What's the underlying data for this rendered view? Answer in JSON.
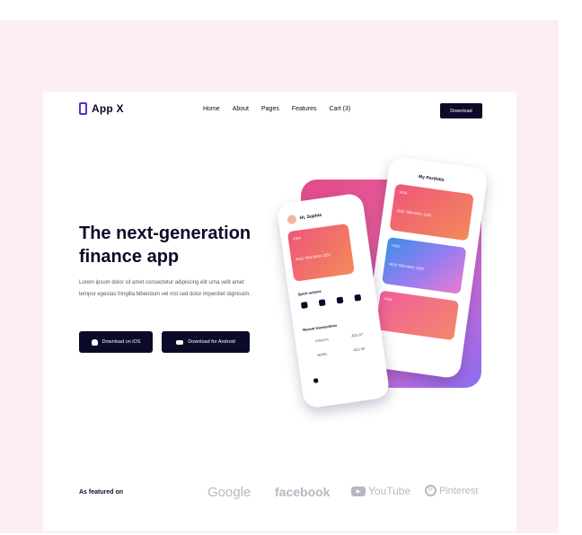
{
  "header": {
    "logo_text": "App X",
    "nav": [
      "Home",
      "About",
      "Pages",
      "Features",
      "Cart (3)"
    ],
    "download_label": "Download"
  },
  "hero": {
    "title": "The next-generation finance app",
    "description": "Lorem ipsum dolor sit amet consectetur adipiscing elit urna velit amet tempor egestas fringilla bibendum vel nisl sed dolor imperdiet dignissim.",
    "ios_button": "Download on iOS",
    "android_button": "Download for Android"
  },
  "mockup": {
    "back_phone_title": "My Portfolio",
    "front_phone_greeting": "Hi, Sophie",
    "card_number": "4532 7854 9641 1253",
    "card_brand": "VISA",
    "quick_actions_label": "Quick actions",
    "recent_transactions_label": "Recent transactions",
    "amount_1": "-$25.87",
    "amount_2": "-$12.60",
    "item_1": "Amazon",
    "item_2": "Netflix"
  },
  "featured": {
    "label": "As featured on",
    "brands": [
      "Google",
      "facebook",
      "YouTube",
      "Pinterest"
    ]
  },
  "colors": {
    "dark": "#0b0a29",
    "accent": "#5a2bd6",
    "muted_logo": "#b8b8c4",
    "outer_background": "#fdeef4"
  }
}
